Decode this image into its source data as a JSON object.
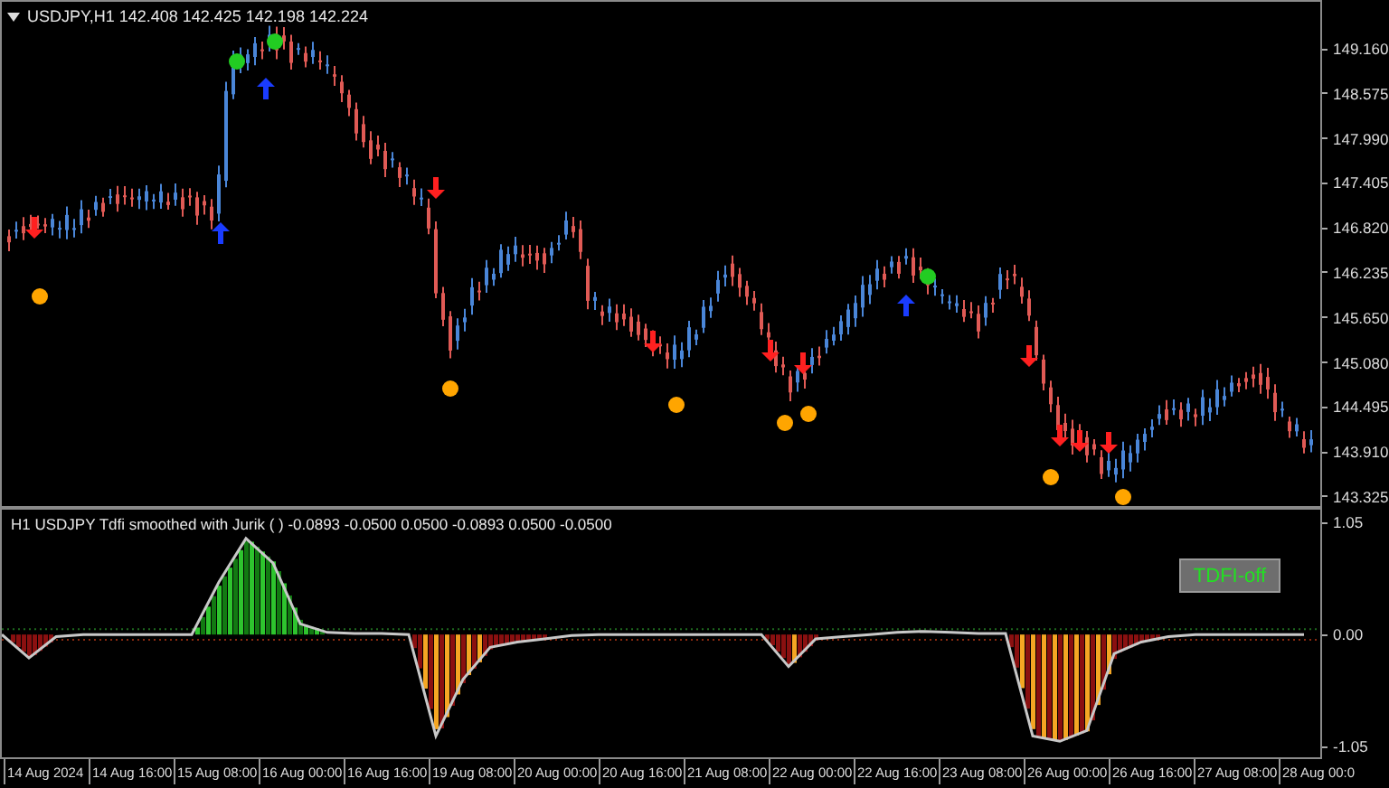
{
  "chart": {
    "symbol_label": "USDJPY,H1 142.408 142.425 142.198 142.224",
    "price_axis": [
      "149.160",
      "148.575",
      "147.990",
      "147.405",
      "146.820",
      "146.235",
      "145.650",
      "145.080",
      "144.495",
      "143.910",
      "143.325"
    ]
  },
  "indicator": {
    "title": "H1 USDJPY Tdfi smoothed with Jurik ( ) -0.0893 -0.0500 0.0500 -0.0893 0.0500 -0.0500",
    "button": "TDFI-off",
    "chart_data": {
      "type": "line",
      "ylim": [
        -1.15,
        1.17
      ],
      "yticks": [
        {
          "value": 1.05,
          "label": "1.05"
        },
        {
          "value": 0,
          "label": "0.00"
        },
        {
          "value": -1.05,
          "label": "-1.05"
        }
      ],
      "series": [
        {
          "color": "#c8c8c8",
          "values": [
            0,
            -0.22,
            -0.02,
            0,
            0,
            0,
            0,
            0,
            0.49,
            0.9,
            0.67,
            0.1,
            0.02,
            0.01,
            0.01,
            0,
            -0.95,
            -0.42,
            -0.12,
            -0.07,
            -0.04,
            -0.01,
            0,
            0,
            0,
            0,
            0,
            0,
            0,
            -0.3,
            -0.04,
            -0.02,
            0,
            0.02,
            0.03,
            0.02,
            0.01,
            0.01,
            -0.95,
            -1.0,
            -0.9,
            -0.18,
            -0.07,
            -0.02,
            0,
            0,
            0,
            0,
            0
          ]
        }
      ]
    }
  },
  "time_axis": [
    "14 Aug 2024",
    "14 Aug 16:00",
    "15 Aug 08:00",
    "16 Aug 00:00",
    "16 Aug 16:00",
    "19 Aug 08:00",
    "20 Aug 00:00",
    "20 Aug 16:00",
    "21 Aug 08:00",
    "22 Aug 00:00",
    "22 Aug 16:00",
    "23 Aug 08:00",
    "26 Aug 00:00",
    "26 Aug 16:00",
    "27 Aug 08:00",
    "28 Aug 00:0"
  ]
}
